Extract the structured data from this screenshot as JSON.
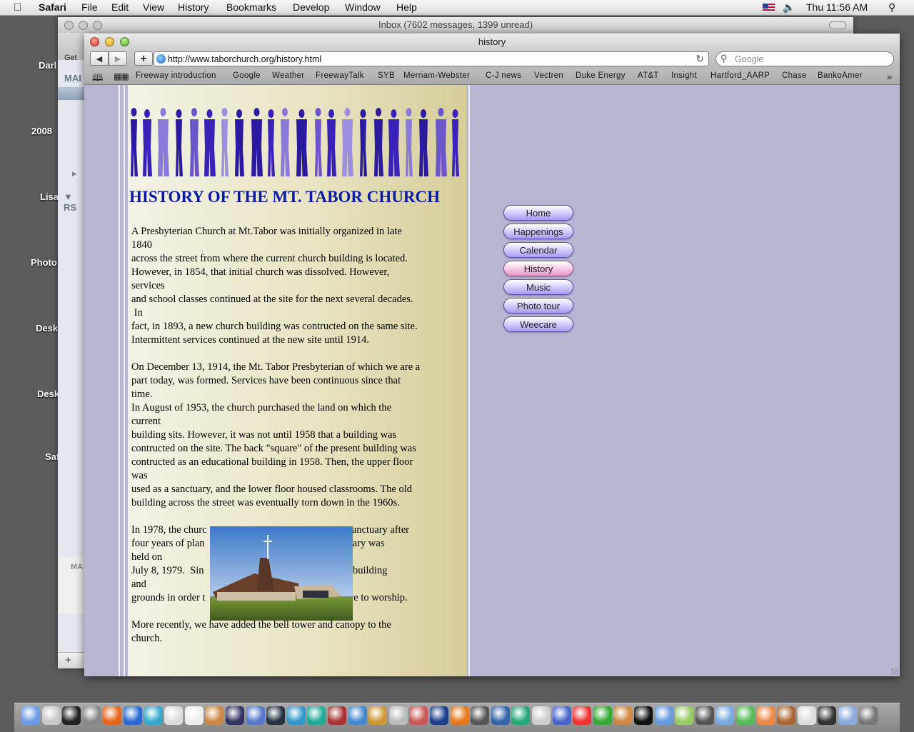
{
  "menubar": {
    "app": "Safari",
    "items": [
      "File",
      "Edit",
      "View",
      "History",
      "Bookmarks",
      "Develop",
      "Window",
      "Help"
    ],
    "clock": "Thu 11:56 AM"
  },
  "desktop": {
    "labels": [
      "Darl",
      "2008",
      "Lisa",
      "Photo:",
      "Desk",
      "Desk",
      "Saf"
    ]
  },
  "mail": {
    "title": "Inbox (7602 messages, 1399 unread)",
    "get": "Get M",
    "mai": "MAI",
    "rs": "RS",
    "ma": "MA",
    "plus": "+"
  },
  "safari": {
    "title": "history",
    "url": "http://www.taborchurch.org/history.html",
    "search_placeholder": "Google",
    "bookmarks": [
      "Freeway introduction",
      "Google",
      "Weather",
      "FreewayTalk",
      "SYB",
      "Merriam-Webster",
      "C-J news",
      "Vectren",
      "Duke Energy",
      "AT&T",
      "Insight",
      "Hartford_AARP",
      "Chase",
      "BankoAmer"
    ]
  },
  "page": {
    "heading": "HISTORY OF THE MT. TABOR CHURCH",
    "para1": [
      "A Presbyterian Church at Mt.Tabor was initially organized in late",
      "1840",
      "across the street from where the current church building is located.",
      "However, in 1854, that initial church was dissolved.  However,",
      "services",
      "and school classes continued at the site for the next several decades.",
      " In",
      "fact, in 1893, a new church building was contructed on the same site.",
      "Intermittent services continued at the new site until 1914."
    ],
    "para2": [
      "On December 13, 1914, the Mt. Tabor Presbyterian of which we are a",
      "part today, was formed.  Services have been continuous since that",
      "time.",
      "In August of 1953, the church purchased the land on which the",
      "current",
      "building sits.  However, it was not until 1958 that a building was",
      "contructed on the site.  The back \"square\" of the present building was",
      "contructed as an educational building in 1958.  Then, the upper floor",
      "was",
      "used as a sanctuary, and the lower floor housed classrooms.  The old",
      "building across the street was eventually torn down in the 1960s."
    ],
    "para3": [
      "In 1978, the churc                                            urrent sanctuary after",
      "four years of plan                                           w sanctuary was",
      "held on",
      "July 8, 1979.  Sin                                             up\" the building",
      "and",
      "grounds in order t                                           tiful place to worship."
    ],
    "para4": [
      "More recently, we have added the bell tower and canopy to the",
      "church."
    ],
    "nav": [
      "Home",
      "Happenings",
      "Calendar",
      "History",
      "Music",
      "Photo tour",
      "Weecare"
    ],
    "active_nav": "History"
  }
}
